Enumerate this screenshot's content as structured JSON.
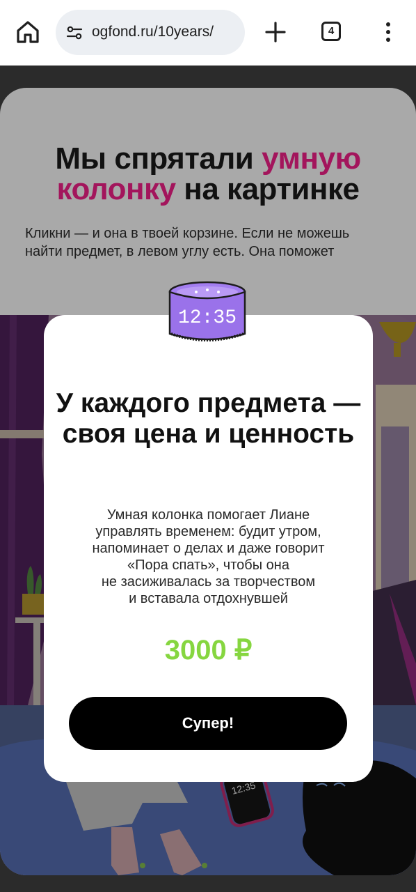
{
  "browser": {
    "url": "ogfond.ru/10years/",
    "tab_count": "4"
  },
  "page": {
    "heading_part1": "Мы спрятали ",
    "heading_accent1": "умную",
    "heading_accent2": "колонку",
    "heading_part2": " на картинке",
    "subtext_line1": "Кликни — и она в твоей корзине. Если не можешь",
    "subtext_line2": "найти предмет, в левом углу есть. Она поможет"
  },
  "modal": {
    "title": "У каждого предмета — своя цена и ценность",
    "text": "Умная колонка помогает Лиане\nуправлять временем: будит утром,\nнапоминает о делах и даже говорит\n«Пора спать», чтобы она\nне засиживалась за творчеством\nи вставала отдохнувшей",
    "price": "3000 ₽",
    "button_label": "Супер!"
  },
  "illustration": {
    "speaker_time": "12:35",
    "phone_time": "12:35"
  },
  "colors": {
    "accent": "#a3155c",
    "price": "#86d640",
    "button": "#000000"
  }
}
